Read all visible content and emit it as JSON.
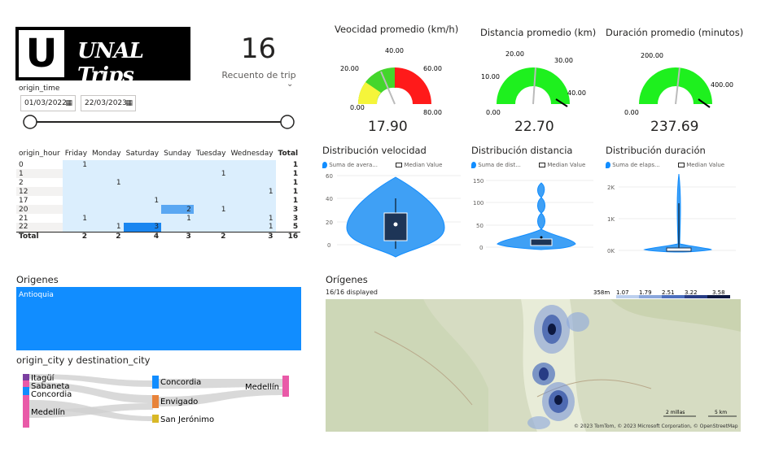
{
  "brand": {
    "logo_letter": "U",
    "logo_text": "UNAL Trips"
  },
  "kpi": {
    "count": "16",
    "count_label": "Recuento de trip"
  },
  "filter": {
    "label": "origin_time",
    "start": "01/03/2022",
    "end": "22/03/2023",
    "chevron": "⌄"
  },
  "gauges": [
    {
      "title": "Veocidad promedio (km/h)",
      "value": "17.90",
      "ticks": [
        "0.00",
        "20.00",
        "40.00",
        "60.00",
        "80.00"
      ]
    },
    {
      "title": "Distancia promedio (km)",
      "value": "22.70",
      "ticks": [
        "0.00",
        "10.00",
        "20.00",
        "30.00",
        "40.00"
      ]
    },
    {
      "title": "Duración promedio (minutos)",
      "value": "237.69",
      "ticks": [
        "0.00",
        "200.00",
        "400.00"
      ]
    }
  ],
  "matrix": {
    "headers": [
      "origin_hour",
      "Friday",
      "Monday",
      "Saturday",
      "Sunday",
      "Tuesday",
      "Wednesday",
      "Total"
    ],
    "rows": [
      [
        "0",
        "1",
        "",
        "",
        "",
        "",
        "",
        "1"
      ],
      [
        "1",
        "",
        "",
        "",
        "",
        "1",
        "",
        "1"
      ],
      [
        "2",
        "",
        "1",
        "",
        "",
        "",
        "",
        "1"
      ],
      [
        "12",
        "",
        "",
        "",
        "",
        "",
        "1",
        "1"
      ],
      [
        "17",
        "",
        "",
        "1",
        "",
        "",
        "",
        "1"
      ],
      [
        "20",
        "",
        "",
        "",
        "2",
        "1",
        "",
        "3"
      ],
      [
        "21",
        "1",
        "",
        "",
        "1",
        "",
        "1",
        "3"
      ],
      [
        "22",
        "",
        "1",
        "3",
        "",
        "",
        "1",
        "5"
      ]
    ],
    "total": [
      "Total",
      "2",
      "2",
      "4",
      "3",
      "2",
      "3",
      "16"
    ]
  },
  "violins": [
    {
      "title": "Distribución velocidad",
      "legend_a": "Suma de avera...",
      "legend_b": "Median Value",
      "ticks": [
        "60",
        "40",
        "20",
        "0"
      ]
    },
    {
      "title": "Distribución distancia",
      "legend_a": "Suma de dist...",
      "legend_b": "Median Value",
      "ticks": [
        "150",
        "100",
        "50",
        "0"
      ]
    },
    {
      "title": "Distribución duración",
      "legend_a": "Suma de elaps...",
      "legend_b": "Median Value",
      "ticks": [
        "2K",
        "1K",
        "0K"
      ]
    }
  ],
  "origenes_left": {
    "title": "Origenes",
    "bar_label": "Antioquia"
  },
  "sankey": {
    "title": "origin_city y destination_city",
    "left": [
      "Itagüí",
      "Sabaneta",
      "Concordia",
      "Medellín"
    ],
    "mid": [
      "Concordia",
      "Envigado",
      "San Jerónimo"
    ],
    "right": [
      "Medellín"
    ]
  },
  "map": {
    "title": "Orígenes",
    "displayed": "16/16 displayed",
    "legend": [
      "358m",
      "1.07",
      "1.79",
      "2.51",
      "3.22",
      "3.58"
    ],
    "scale_a": "2 millas",
    "scale_b": "5 km",
    "attribution": "© 2023 TomTom, © 2023 Microsoft Corporation, © OpenStreetMap"
  },
  "colors": {
    "accent": "#118dff",
    "gauge_green": "#1ef01e",
    "gauge_red": "#ff1a1a",
    "gauge_yellow": "#f5f53a"
  }
}
